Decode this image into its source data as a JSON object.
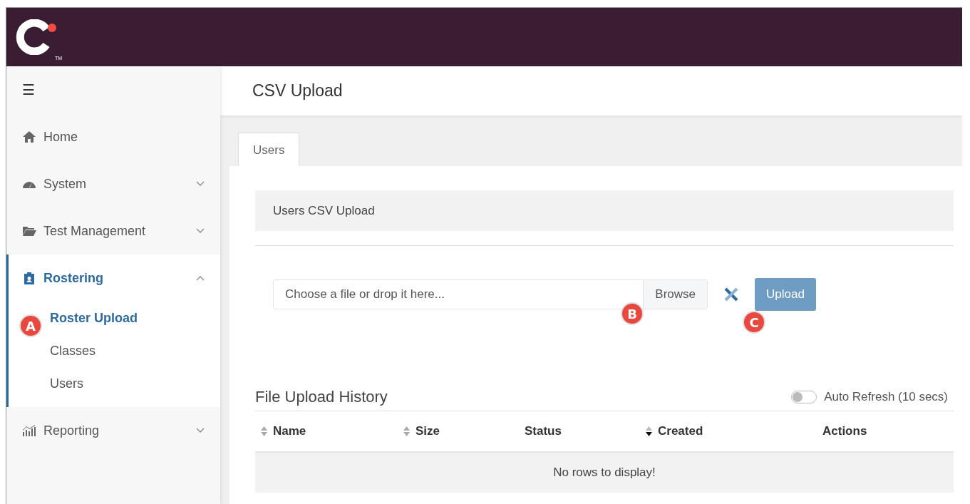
{
  "header": {
    "logo_mark": "TM"
  },
  "sidebar": {
    "menu_icon": "☰",
    "items": [
      {
        "label": "Home",
        "kind": "home",
        "expandable": false,
        "expanded": false,
        "selected": false
      },
      {
        "label": "System",
        "kind": "gauge",
        "expandable": true,
        "expanded": false,
        "selected": false
      },
      {
        "label": "Test Management",
        "kind": "folder",
        "expandable": true,
        "expanded": false,
        "selected": false
      },
      {
        "label": "Rostering",
        "kind": "clipboard",
        "expandable": true,
        "expanded": true,
        "selected": true,
        "children": [
          {
            "label": "Roster Upload",
            "selected": true,
            "callout": "A"
          },
          {
            "label": "Classes",
            "selected": false
          },
          {
            "label": "Users",
            "selected": false
          }
        ]
      },
      {
        "label": "Reporting",
        "kind": "chart",
        "expandable": true,
        "expanded": false,
        "selected": false
      }
    ]
  },
  "page": {
    "title": "CSV Upload"
  },
  "tabs": [
    {
      "label": "Users",
      "selected": true
    }
  ],
  "panel": {
    "title": "Users CSV Upload"
  },
  "upload": {
    "placeholder": "Choose a file or drop it here...",
    "browse": "Browse",
    "browse_callout": "B",
    "button": "Upload",
    "button_disabled": true,
    "button_callout": "C"
  },
  "history": {
    "title": "File Upload History",
    "auto_refresh": {
      "label": "Auto Refresh (10 secs)",
      "on": false
    },
    "columns": [
      {
        "label": "Name",
        "sortable": true,
        "sorted_desc": false
      },
      {
        "label": "Size",
        "sortable": true,
        "sorted_desc": false
      },
      {
        "label": "Status",
        "sortable": false
      },
      {
        "label": "Created",
        "sortable": true,
        "sorted_desc": true
      },
      {
        "label": "Actions",
        "sortable": false
      }
    ],
    "empty": "No rows to display!"
  }
}
